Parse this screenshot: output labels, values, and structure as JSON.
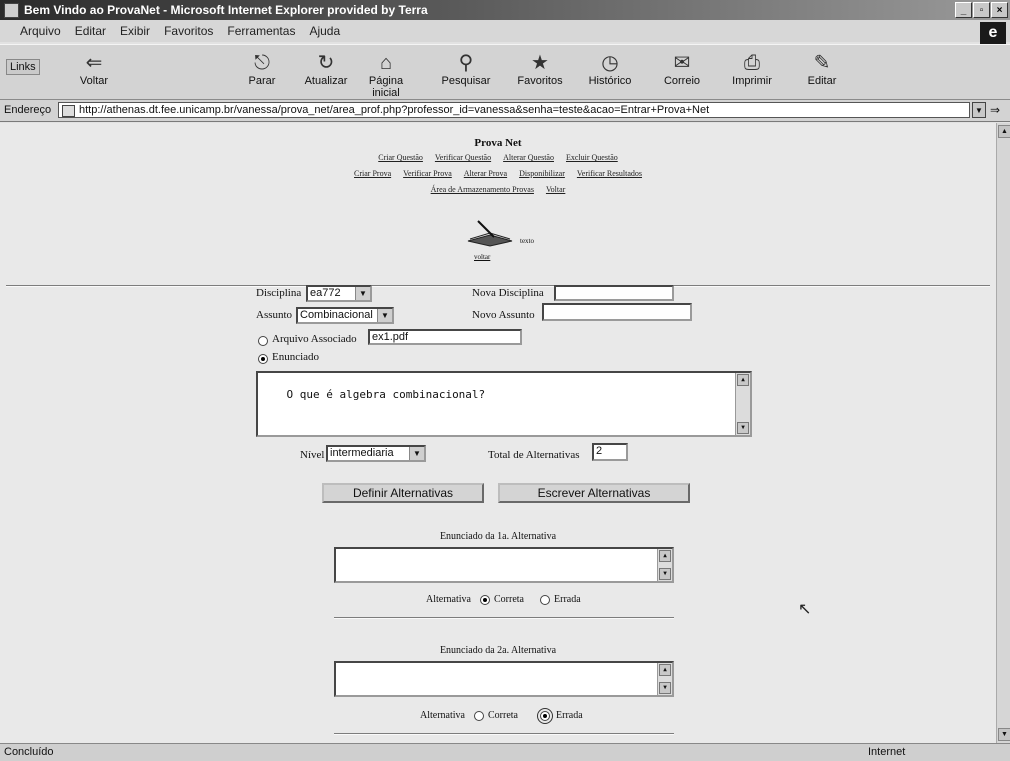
{
  "window": {
    "title": "Bem Vindo ao ProvaNet - Microsoft Internet Explorer provided by Terra",
    "controls": [
      "_",
      "▫",
      "×"
    ]
  },
  "menu": [
    "Arquivo",
    "Editar",
    "Exibir",
    "Favoritos",
    "Ferramentas",
    "Ajuda"
  ],
  "toolbar": {
    "links_label": "Links",
    "buttons": [
      {
        "label": "Voltar",
        "icon": "back-arrow-icon"
      },
      {
        "label": "Parar",
        "icon": "stop-icon"
      },
      {
        "label": "Atualizar",
        "icon": "refresh-icon"
      },
      {
        "label": "Página inicial",
        "icon": "home-icon"
      },
      {
        "label": "Pesquisar",
        "icon": "search-icon"
      },
      {
        "label": "Favoritos",
        "icon": "favorites-icon"
      },
      {
        "label": "Histórico",
        "icon": "history-icon"
      },
      {
        "label": "Correio",
        "icon": "mail-icon"
      },
      {
        "label": "Imprimir",
        "icon": "print-icon"
      },
      {
        "label": "Editar",
        "icon": "edit-icon"
      }
    ]
  },
  "address": {
    "label": "Endereço",
    "url": "http://athenas.dt.fee.unicamp.br/vanessa/prova_net/area_prof.php?professor_id=vanessa&senha=teste&acao=Entrar+Prova+Net"
  },
  "page": {
    "title": "Prova Net",
    "nav_rows": [
      [
        "Criar Questão",
        "Verificar Questão",
        "Alterar Questão",
        "Excluir Questão"
      ],
      [
        "Criar Prova",
        "Verificar Prova",
        "Alterar Prova",
        "Disponibilizar",
        "Verificar Resultados"
      ],
      [
        "Área de Armazenamento Provas",
        "Voltar"
      ]
    ],
    "icon_caption": "texto",
    "icon_caption2": "voltar",
    "form": {
      "disciplina_label": "Disciplina",
      "disciplina_value": "ea772",
      "nova_disciplina_label": "Nova Disciplina",
      "nova_disciplina_value": "",
      "assunto_label": "Assunto",
      "assunto_value": "Combinacional",
      "novo_assunto_label": "Novo Assunto",
      "novo_assunto_value": "",
      "arquivo_label": "Arquivo Associado",
      "arquivo_value": "ex1.pdf",
      "enunciado_label": "Enunciado",
      "enunciado_text": "O que é algebra combinacional?",
      "nivel_label": "Nível",
      "nivel_value": "intermediaria",
      "total_label": "Total de Alternativas",
      "total_value": "2",
      "definir_button": "Definir Alternativas",
      "escrever_button": "Escrever Alternativas",
      "alternatives": [
        {
          "heading": "Enunciado da 1a. Alternativa",
          "text": "",
          "tipo_label": "Alternativa",
          "correta": "Correta",
          "errada": "Errada",
          "selected": "correta"
        },
        {
          "heading": "Enunciado da 2a. Alternativa",
          "text": "",
          "tipo_label": "Alternativa",
          "correta": "Correta",
          "errada": "Errada",
          "selected": "errada"
        }
      ]
    }
  },
  "status": {
    "left": "Concluído",
    "right": "Internet"
  }
}
